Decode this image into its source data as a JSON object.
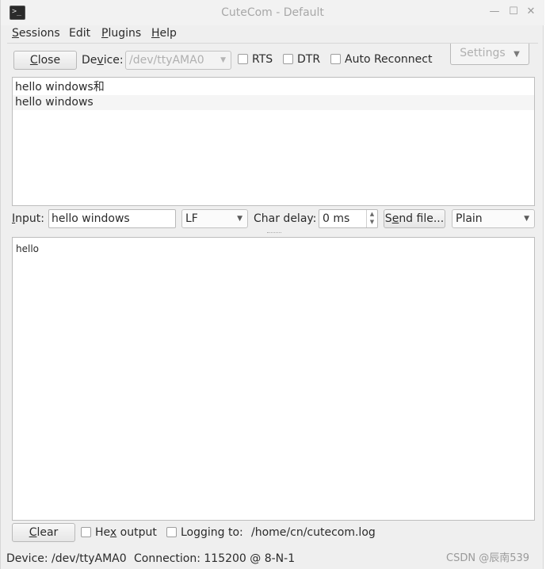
{
  "window": {
    "title": "CuteCom - Default",
    "icon_glyph": ">_"
  },
  "menu": {
    "sessions": {
      "mnemonic": "S",
      "rest": "essions"
    },
    "edit": {
      "label": "Edit"
    },
    "plugins": {
      "mnemonic": "P",
      "rest": "lugins"
    },
    "help": {
      "mnemonic": "H",
      "rest": "elp"
    }
  },
  "toolbar": {
    "close": {
      "mnemonic": "C",
      "rest": "lose"
    },
    "device": {
      "pre": "De",
      "mnemonic": "v",
      "post": "ice:"
    },
    "device_value": "/dev/ttyAMA0",
    "rts_label": "RTS",
    "dtr_label": "DTR",
    "auto_reconnect_label": "Auto Reconnect",
    "settings_label": "Settings"
  },
  "output_lines": [
    "hello windows和",
    "hello windows"
  ],
  "input_row": {
    "input": {
      "mnemonic": "I",
      "rest": "nput:"
    },
    "input_value": "hello windows",
    "line_end_value": "LF",
    "char_delay_label": "Char delay:",
    "char_delay_value": "0 ms",
    "send_file": {
      "pre": "S",
      "mnemonic": "e",
      "post": "nd file..."
    },
    "format_value": "Plain"
  },
  "log_text": "hello",
  "bottom_row": {
    "clear": {
      "mnemonic": "C",
      "rest": "lear"
    },
    "hex_output": {
      "pre": "He",
      "mnemonic": "x",
      "post": " output"
    },
    "logging_label": "Logging to:",
    "log_path": "/home/cn/cutecom.log"
  },
  "status": {
    "device": "Device:  /dev/ttyAMA0",
    "connection": "Connection:  115200 @ 8-N-1"
  },
  "watermark": "CSDN @辰南539"
}
